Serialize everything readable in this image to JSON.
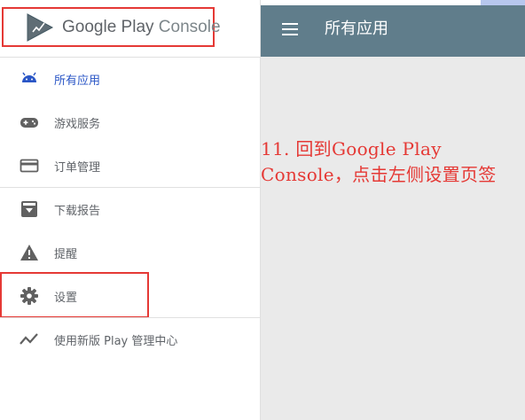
{
  "brand": {
    "logo_text_1": "Google Play",
    "logo_text_2": "Console"
  },
  "header": {
    "title": "所有应用",
    "menu_icon": "hamburger-menu-icon"
  },
  "sidebar": {
    "items": [
      {
        "label": "所有应用",
        "icon": "android-icon",
        "active": true
      },
      {
        "label": "游戏服务",
        "icon": "gamepad-icon"
      },
      {
        "label": "订单管理",
        "icon": "credit-card-icon"
      },
      {
        "label": "下载报告",
        "icon": "download-box-icon"
      },
      {
        "label": "提醒",
        "icon": "warning-icon"
      },
      {
        "label": "设置",
        "icon": "gear-icon"
      },
      {
        "label": "使用新版 Play 管理中心",
        "icon": "trending-icon"
      }
    ]
  },
  "annotation": {
    "text": "11. 回到Google Play Console，点击左侧设置页签"
  },
  "colors": {
    "header_bg": "#607d8b",
    "accent": "#2a56c6",
    "highlight": "#e53935",
    "content_bg": "#eaeaea"
  }
}
